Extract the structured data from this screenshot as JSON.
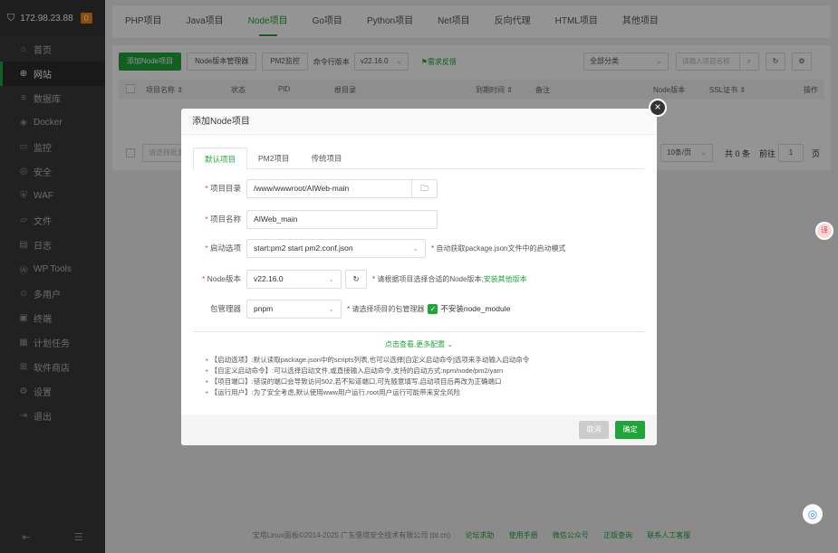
{
  "sidebar": {
    "ip": "172.98.23.88",
    "badge": "0",
    "items": [
      {
        "label": "首页",
        "icon": "home-icon",
        "glyph": "⌂"
      },
      {
        "label": "网站",
        "icon": "globe-icon",
        "glyph": "⊕"
      },
      {
        "label": "数据库",
        "icon": "database-icon",
        "glyph": "≡"
      },
      {
        "label": "Docker",
        "icon": "docker-icon",
        "glyph": "◈"
      },
      {
        "label": "监控",
        "icon": "monitor-icon",
        "glyph": "▭"
      },
      {
        "label": "安全",
        "icon": "shield-icon",
        "glyph": "◎"
      },
      {
        "label": "WAF",
        "icon": "waf-icon",
        "glyph": "⛨"
      },
      {
        "label": "文件",
        "icon": "folder-icon",
        "glyph": "▱"
      },
      {
        "label": "日志",
        "icon": "log-icon",
        "glyph": "▤"
      },
      {
        "label": "WP Tools",
        "icon": "wordpress-icon",
        "glyph": "Ⓦ"
      },
      {
        "label": "多用户",
        "icon": "users-icon",
        "glyph": "☺"
      },
      {
        "label": "终端",
        "icon": "terminal-icon",
        "glyph": "▣"
      },
      {
        "label": "计划任务",
        "icon": "calendar-icon",
        "glyph": "▦"
      },
      {
        "label": "软件商店",
        "icon": "apps-icon",
        "glyph": "⊞"
      },
      {
        "label": "设置",
        "icon": "gear-icon",
        "glyph": "⚙"
      },
      {
        "label": "退出",
        "icon": "logout-icon",
        "glyph": "⇥"
      }
    ]
  },
  "tabs": [
    "PHP项目",
    "Java项目",
    "Node项目",
    "Go项目",
    "Python项目",
    "Net项目",
    "反向代理",
    "HTML项目",
    "其他项目"
  ],
  "toolbar": {
    "add_node": "添加Node项目",
    "version_manager": "Node版本管理器",
    "pm2": "PM2监控",
    "cli_version_label": "命令行版本",
    "cli_version": "v22.16.0",
    "feedback": "需求反馈",
    "category": "全部分类",
    "search_placeholder": "请输入项目名称"
  },
  "table": {
    "headers": [
      "项目名称 ⇕",
      "状态",
      "PID",
      "根目录",
      "到期时间 ⇕",
      "备注",
      "Node版本",
      "SSL证书 ⇕",
      "操作"
    ]
  },
  "pagination": {
    "batch_placeholder": "请选择批量",
    "per_page": "10条/页",
    "total": "共 0 条",
    "goto": "前往",
    "page": "1",
    "page_suffix": "页"
  },
  "dialog": {
    "title": "添加Node项目",
    "tabs": [
      "默认项目",
      "PM2项目",
      "传统项目"
    ],
    "dir_label": "项目目录",
    "dir_value": "/www/wwwroot/AIWeb-main",
    "name_label": "项目名称",
    "name_value": "AIWeb_main",
    "start_label": "启动选项",
    "start_value": "start:pm2 start pm2.conf.json",
    "start_hint": "* 自动获取package.json文件中的启动模式",
    "node_label": "Node版本",
    "node_value": "v22.16.0",
    "node_hint": "* 请根据项目选择合适的Node版本,",
    "node_link": "安装其他版本",
    "pm_label": "包管理器",
    "pm_value": "pnpm",
    "pm_hint": "* 请选择项目的包管理器",
    "no_install": "不安装node_module",
    "more": "点击查看,更多配置",
    "tips": [
      "【启动选项】:默认读取package.json中的scripts列表,也可以选择[自定义启动命令]选项来手动输入启动命令",
      "【自定义启动命令】:可以选择启动文件,或直接输入启动命令,支持的启动方式:npm/node/pm2/yarn",
      "【项目端口】:错误的端口会导致访问502,若不知道端口,可先随意填写,启动项目后再改为正确端口",
      "【运行用户】:为了安全考虑,默认使用www用户运行,root用户运行可能带来安全风险"
    ],
    "cancel": "取消",
    "confirm": "确定"
  },
  "footer": {
    "copyright": "宝塔Linux面板©2014-2025 广东堡塔安全技术有限公司 (bt.cn)",
    "links": [
      "论坛求助",
      "使用手册",
      "微信公众号",
      "正版查询",
      "联系人工客服"
    ]
  },
  "colors": {
    "accent": "#20a53a",
    "sidebar": "#3a3a3a",
    "badge": "#f7841e"
  }
}
